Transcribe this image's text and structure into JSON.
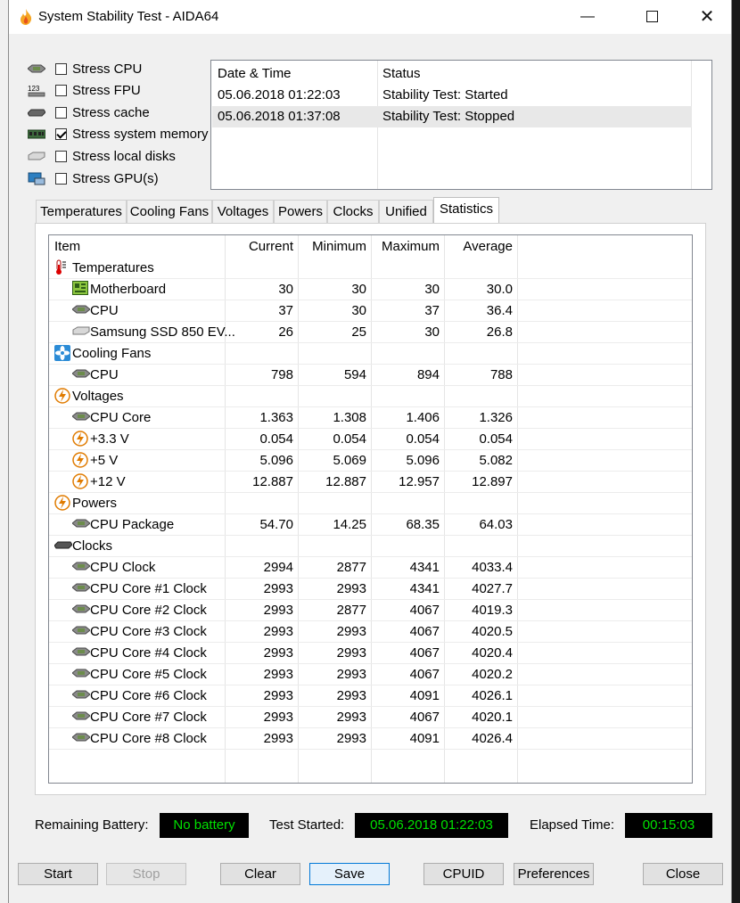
{
  "window": {
    "title": "System Stability Test - AIDA64"
  },
  "stress_options": [
    {
      "label": "Stress CPU",
      "checked": false,
      "icon": "cpu-chip-icon"
    },
    {
      "label": "Stress FPU",
      "checked": false,
      "icon": "fpu-123-icon"
    },
    {
      "label": "Stress cache",
      "checked": false,
      "icon": "cache-chip-icon"
    },
    {
      "label": "Stress system memory",
      "checked": true,
      "icon": "memory-module-icon"
    },
    {
      "label": "Stress local disks",
      "checked": false,
      "icon": "disk-icon"
    },
    {
      "label": "Stress GPU(s)",
      "checked": false,
      "icon": "gpu-icon"
    }
  ],
  "log": {
    "headers": [
      "Date & Time",
      "Status"
    ],
    "rows": [
      {
        "datetime": "05.06.2018 01:22:03",
        "status": "Stability Test: Started"
      },
      {
        "datetime": "05.06.2018 01:37:08",
        "status": "Stability Test: Stopped"
      }
    ]
  },
  "tabs": [
    "Temperatures",
    "Cooling Fans",
    "Voltages",
    "Powers",
    "Clocks",
    "Unified",
    "Statistics"
  ],
  "active_tab": "Statistics",
  "stats": {
    "headers": [
      "Item",
      "Current",
      "Minimum",
      "Maximum",
      "Average"
    ],
    "rows": [
      {
        "type": "group",
        "icon": "thermometer-icon",
        "label": "Temperatures"
      },
      {
        "type": "item",
        "icon": "motherboard-icon",
        "label": "Motherboard",
        "current": "30",
        "min": "30",
        "max": "30",
        "avg": "30.0"
      },
      {
        "type": "item",
        "icon": "cpu-chip-icon",
        "label": "CPU",
        "current": "37",
        "min": "30",
        "max": "37",
        "avg": "36.4"
      },
      {
        "type": "item",
        "icon": "disk-icon",
        "label": "Samsung SSD 850 EV...",
        "current": "26",
        "min": "25",
        "max": "30",
        "avg": "26.8"
      },
      {
        "type": "group",
        "icon": "fan-icon",
        "label": "Cooling Fans"
      },
      {
        "type": "item",
        "icon": "cpu-chip-icon",
        "label": "CPU",
        "current": "798",
        "min": "594",
        "max": "894",
        "avg": "788"
      },
      {
        "type": "group",
        "icon": "lightning-icon",
        "label": "Voltages"
      },
      {
        "type": "item",
        "icon": "cpu-chip-icon",
        "label": "CPU Core",
        "current": "1.363",
        "min": "1.308",
        "max": "1.406",
        "avg": "1.326"
      },
      {
        "type": "item",
        "icon": "lightning-icon",
        "label": "+3.3 V",
        "current": "0.054",
        "min": "0.054",
        "max": "0.054",
        "avg": "0.054"
      },
      {
        "type": "item",
        "icon": "lightning-icon",
        "label": "+5 V",
        "current": "5.096",
        "min": "5.069",
        "max": "5.096",
        "avg": "5.082"
      },
      {
        "type": "item",
        "icon": "lightning-icon",
        "label": "+12 V",
        "current": "12.887",
        "min": "12.887",
        "max": "12.957",
        "avg": "12.897"
      },
      {
        "type": "group",
        "icon": "lightning-icon",
        "label": "Powers"
      },
      {
        "type": "item",
        "icon": "cpu-chip-icon",
        "label": "CPU Package",
        "current": "54.70",
        "min": "14.25",
        "max": "68.35",
        "avg": "64.03"
      },
      {
        "type": "group",
        "icon": "clock-chip-icon",
        "label": "Clocks"
      },
      {
        "type": "item",
        "icon": "cpu-chip-icon",
        "label": "CPU Clock",
        "current": "2994",
        "min": "2877",
        "max": "4341",
        "avg": "4033.4"
      },
      {
        "type": "item",
        "icon": "cpu-chip-icon",
        "label": "CPU Core #1 Clock",
        "current": "2993",
        "min": "2993",
        "max": "4341",
        "avg": "4027.7"
      },
      {
        "type": "item",
        "icon": "cpu-chip-icon",
        "label": "CPU Core #2 Clock",
        "current": "2993",
        "min": "2877",
        "max": "4067",
        "avg": "4019.3"
      },
      {
        "type": "item",
        "icon": "cpu-chip-icon",
        "label": "CPU Core #3 Clock",
        "current": "2993",
        "min": "2993",
        "max": "4067",
        "avg": "4020.5"
      },
      {
        "type": "item",
        "icon": "cpu-chip-icon",
        "label": "CPU Core #4 Clock",
        "current": "2993",
        "min": "2993",
        "max": "4067",
        "avg": "4020.4"
      },
      {
        "type": "item",
        "icon": "cpu-chip-icon",
        "label": "CPU Core #5 Clock",
        "current": "2993",
        "min": "2993",
        "max": "4067",
        "avg": "4020.2"
      },
      {
        "type": "item",
        "icon": "cpu-chip-icon",
        "label": "CPU Core #6 Clock",
        "current": "2993",
        "min": "2993",
        "max": "4091",
        "avg": "4026.1"
      },
      {
        "type": "item",
        "icon": "cpu-chip-icon",
        "label": "CPU Core #7 Clock",
        "current": "2993",
        "min": "2993",
        "max": "4067",
        "avg": "4020.1"
      },
      {
        "type": "item",
        "icon": "cpu-chip-icon",
        "label": "CPU Core #8 Clock",
        "current": "2993",
        "min": "2993",
        "max": "4091",
        "avg": "4026.4"
      }
    ]
  },
  "status_bar": {
    "battery_label": "Remaining Battery:",
    "battery_value": "No battery",
    "started_label": "Test Started:",
    "started_value": "05.06.2018 01:22:03",
    "elapsed_label": "Elapsed Time:",
    "elapsed_value": "00:15:03"
  },
  "buttons": {
    "start": "Start",
    "stop": "Stop",
    "clear": "Clear",
    "save": "Save",
    "cpuid": "CPUID",
    "preferences": "Preferences",
    "close": "Close"
  },
  "colors": {
    "lcd_text": "#00e000",
    "lcd_bg": "#000000",
    "accent": "#0078d7"
  }
}
